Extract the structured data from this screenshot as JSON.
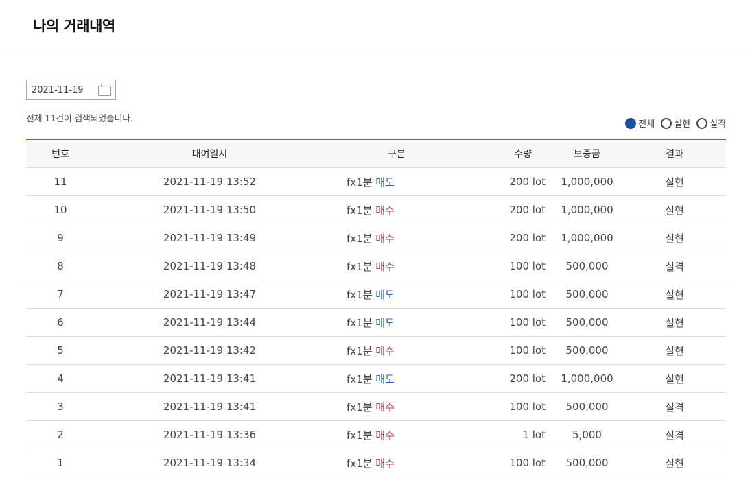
{
  "page": {
    "title": "나의 거래내역"
  },
  "filter": {
    "date": "2021-11-19",
    "result_count": "전체 11건이 검색되었습니다.",
    "options": [
      {
        "label": "전체",
        "checked": true
      },
      {
        "label": "실현",
        "checked": false
      },
      {
        "label": "실격",
        "checked": false
      }
    ]
  },
  "table": {
    "headers": [
      "번호",
      "대여일시",
      "구분",
      "수량",
      "보증금",
      "결과"
    ],
    "rows": [
      {
        "no": "11",
        "datetime": "2021-11-19 13:52",
        "product": "fx1분",
        "side": "매도",
        "side_kind": "sell",
        "qty": "200 lot",
        "deposit": "1,000,000",
        "result": "실현",
        "result_kind": "win"
      },
      {
        "no": "10",
        "datetime": "2021-11-19 13:50",
        "product": "fx1분",
        "side": "매수",
        "side_kind": "buy",
        "qty": "200 lot",
        "deposit": "1,000,000",
        "result": "실현",
        "result_kind": "win"
      },
      {
        "no": "9",
        "datetime": "2021-11-19 13:49",
        "product": "fx1분",
        "side": "매수",
        "side_kind": "buy",
        "qty": "200 lot",
        "deposit": "1,000,000",
        "result": "실현",
        "result_kind": "win"
      },
      {
        "no": "8",
        "datetime": "2021-11-19 13:48",
        "product": "fx1분",
        "side": "매수",
        "side_kind": "buy",
        "qty": "100 lot",
        "deposit": "500,000",
        "result": "실격",
        "result_kind": "lose"
      },
      {
        "no": "7",
        "datetime": "2021-11-19 13:47",
        "product": "fx1분",
        "side": "매도",
        "side_kind": "sell",
        "qty": "100 lot",
        "deposit": "500,000",
        "result": "실현",
        "result_kind": "win"
      },
      {
        "no": "6",
        "datetime": "2021-11-19 13:44",
        "product": "fx1분",
        "side": "매도",
        "side_kind": "sell",
        "qty": "100 lot",
        "deposit": "500,000",
        "result": "실현",
        "result_kind": "win"
      },
      {
        "no": "5",
        "datetime": "2021-11-19 13:42",
        "product": "fx1분",
        "side": "매수",
        "side_kind": "buy",
        "qty": "100 lot",
        "deposit": "500,000",
        "result": "실현",
        "result_kind": "win"
      },
      {
        "no": "4",
        "datetime": "2021-11-19 13:41",
        "product": "fx1분",
        "side": "매도",
        "side_kind": "sell",
        "qty": "200 lot",
        "deposit": "1,000,000",
        "result": "실현",
        "result_kind": "win"
      },
      {
        "no": "3",
        "datetime": "2021-11-19 13:41",
        "product": "fx1분",
        "side": "매수",
        "side_kind": "buy",
        "qty": "100 lot",
        "deposit": "500,000",
        "result": "실격",
        "result_kind": "lose"
      },
      {
        "no": "2",
        "datetime": "2021-11-19 13:36",
        "product": "fx1분",
        "side": "매수",
        "side_kind": "buy",
        "qty": "1 lot",
        "deposit": "5,000",
        "result": "실격",
        "result_kind": "lose"
      },
      {
        "no": "1",
        "datetime": "2021-11-19 13:34",
        "product": "fx1분",
        "side": "매수",
        "side_kind": "buy",
        "qty": "100 lot",
        "deposit": "500,000",
        "result": "실현",
        "result_kind": "win"
      }
    ]
  },
  "colors": {
    "sell": "#2d5fa6",
    "buy": "#b23a3a",
    "win": "#3a6fb0",
    "lose": "#b23a3a",
    "radio_checked": "#1e4fa8"
  },
  "icons": {
    "date_picker": "calendar-icon"
  }
}
